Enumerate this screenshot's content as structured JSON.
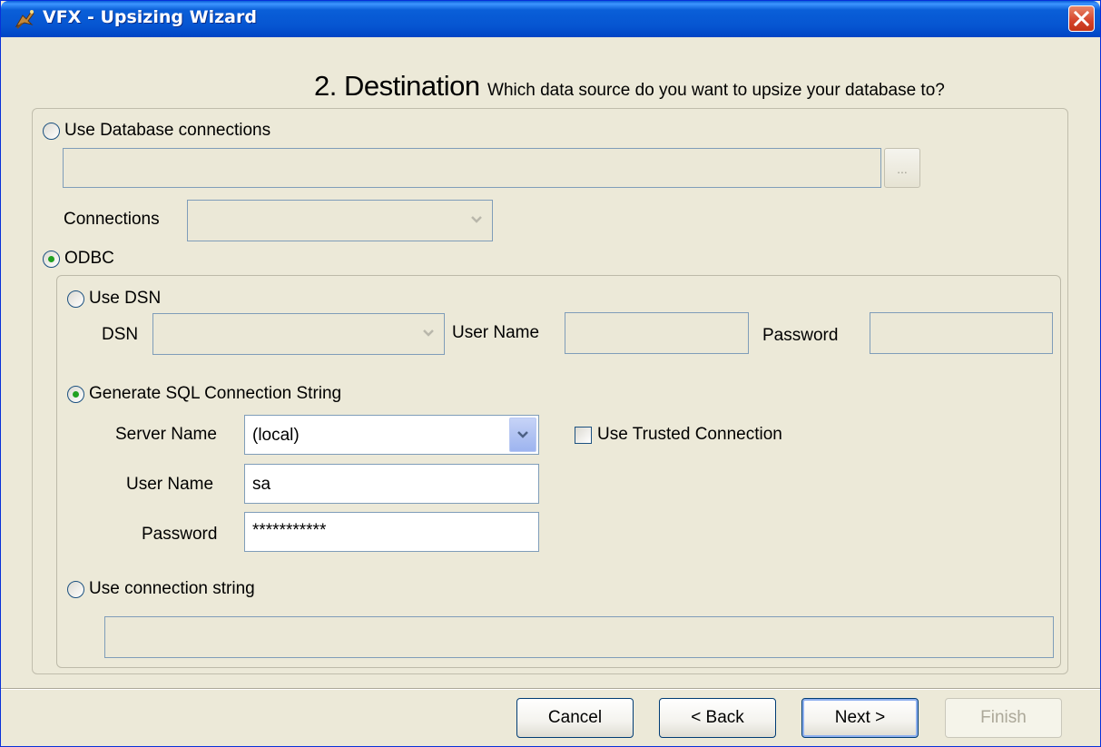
{
  "window": {
    "title": "VFX - Upsizing Wizard",
    "app_icon": "wizard-app-icon",
    "close_icon": "close-icon"
  },
  "heading": {
    "main": "2. Destination",
    "sub": "Which data source do you want to upsize your database to?"
  },
  "database_connections": {
    "option_label": "Use Database connections",
    "selected": false,
    "path_value": "",
    "browse_label": "...",
    "connections_label": "Connections",
    "connections_value": ""
  },
  "odbc": {
    "option_label": "ODBC",
    "selected": true,
    "use_dsn": {
      "option_label": "Use DSN",
      "selected": false,
      "dsn_label": "DSN",
      "dsn_value": "",
      "user_name_label": "User Name",
      "user_name_value": "",
      "password_label": "Password",
      "password_value": ""
    },
    "generate_sql": {
      "option_label": "Generate SQL Connection String",
      "selected": true,
      "server_name_label": "Server Name",
      "server_name_value": "(local)",
      "trusted_connection_label": "Use Trusted Connection",
      "trusted_connection_checked": false,
      "user_name_label": "User Name",
      "user_name_value": "sa",
      "password_label": "Password",
      "password_value": "***********"
    },
    "connection_string": {
      "option_label": "Use connection string",
      "selected": false,
      "value": ""
    }
  },
  "buttons": {
    "cancel": "Cancel",
    "back": "< Back",
    "next": "Next >",
    "finish": "Finish"
  },
  "colors": {
    "titlebar": "#0a5fd8",
    "radio_checked": "#21a121",
    "field_border": "#7f9db9",
    "face": "#ece9d8"
  }
}
